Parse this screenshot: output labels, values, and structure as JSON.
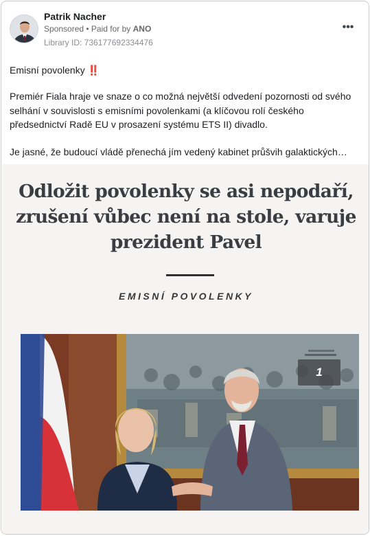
{
  "post": {
    "author": "Patrik Nacher",
    "sponsored": "Sponsored",
    "paid_for_prefix": " • Paid for by ",
    "paid_for_by": "ANO",
    "library_id": "Library ID: 736177692334476",
    "more_label": "•••"
  },
  "text": {
    "title": "Emisní povolenky",
    "title_emoji": "‼️",
    "paragraph1": "Premiér Fiala hraje ve snaze o co možná největší odvedení pozornosti od svého selhání v souvislosti s emisními povolenkami (a klíčovou rolí českého předsednictví Radě EU v prosazení systému ETS II) divadlo.",
    "paragraph2": "Je jasné, že budoucí vládě přenechá jím vedený kabinet průšvih galaktických…"
  },
  "creative": {
    "headline": "Odložit povolenky se asi nepodaří, zrušení vůbec není na stole, varuje prezident Pavel",
    "section": "EMISNÍ POVOLENKY",
    "photo_counter": "1"
  }
}
